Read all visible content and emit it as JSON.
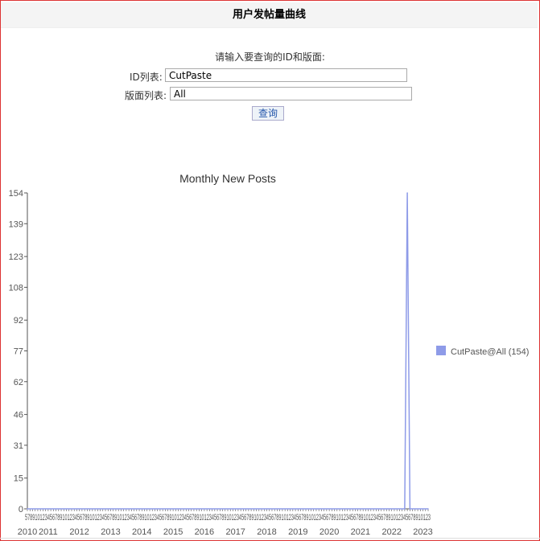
{
  "page": {
    "title": "用户发帖量曲线",
    "prompt": "请输入要查询的ID和版面:",
    "id_label": "ID列表:",
    "id_value": "CutPaste",
    "board_label": "版面列表:",
    "board_value": "All",
    "query_button": "查询"
  },
  "colors": {
    "series": "#8e9be8",
    "axis": "#555555",
    "frame": "#dd3333"
  },
  "chart_data": {
    "type": "line",
    "title": "Monthly New Posts",
    "xlabel": "",
    "ylabel": "",
    "ylim": [
      0,
      154
    ],
    "yticks": [
      0,
      15,
      31,
      46,
      62,
      77,
      92,
      108,
      123,
      139,
      154
    ],
    "year_labels": [
      "2010",
      "2011",
      "2012",
      "2013",
      "2014",
      "2015",
      "2016",
      "2017",
      "2018",
      "2019",
      "2020",
      "2021",
      "2022",
      "2023"
    ],
    "month_tick_text": "5789101234567891012345678910123456789101234567891012345678910123456789101234567891012345678910123456789101234567891012345678910123456789101234567891012345678910123",
    "x_range": [
      "2010-05",
      "2023-03"
    ],
    "series": [
      {
        "name": "CutPaste@All (154)",
        "points": [
          {
            "x": "2010-05",
            "y": 0
          },
          {
            "x": "2022-06",
            "y": 0
          },
          {
            "x": "2022-07",
            "y": 154
          },
          {
            "x": "2022-08",
            "y": 0
          },
          {
            "x": "2023-03",
            "y": 0
          }
        ]
      }
    ],
    "legend": "right",
    "grid": false
  }
}
